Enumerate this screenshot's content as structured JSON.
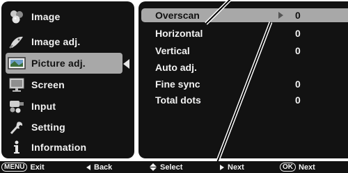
{
  "main_menu": {
    "items": [
      {
        "label": "Image",
        "icon": "color-spheres-icon",
        "selected": false
      },
      {
        "label": "Image adj.",
        "icon": "palette-icon",
        "selected": false
      },
      {
        "label": "Picture adj.",
        "icon": "picture-adjust-icon",
        "selected": true
      },
      {
        "label": "Screen",
        "icon": "screen-icon",
        "selected": false
      },
      {
        "label": "Input",
        "icon": "input-connector-icon",
        "selected": false
      },
      {
        "label": "Setting",
        "icon": "wrench-icon",
        "selected": false
      },
      {
        "label": "Information",
        "icon": "info-icon",
        "selected": false
      }
    ]
  },
  "submenu": {
    "rows": [
      {
        "label": "Overscan",
        "value": "0",
        "highlighted": true
      },
      {
        "label": "Horizontal",
        "value": "0",
        "highlighted": false
      },
      {
        "label": "Vertical",
        "value": "0",
        "highlighted": false
      },
      {
        "label": "Auto adj.",
        "value": "",
        "highlighted": false
      },
      {
        "label": "Fine sync",
        "value": "0",
        "highlighted": false
      },
      {
        "label": "Total dots",
        "value": "0",
        "highlighted": false
      }
    ]
  },
  "guide_bar": {
    "menu_key": "MENU",
    "exit": "Exit",
    "back": "Back",
    "select": "Select",
    "next": "Next",
    "ok_key": "OK",
    "ok_next": "Next"
  },
  "colors": {
    "panel_bg": "#121212",
    "highlight_bg": "#a8a8a8",
    "text": "#f2f2f2"
  }
}
